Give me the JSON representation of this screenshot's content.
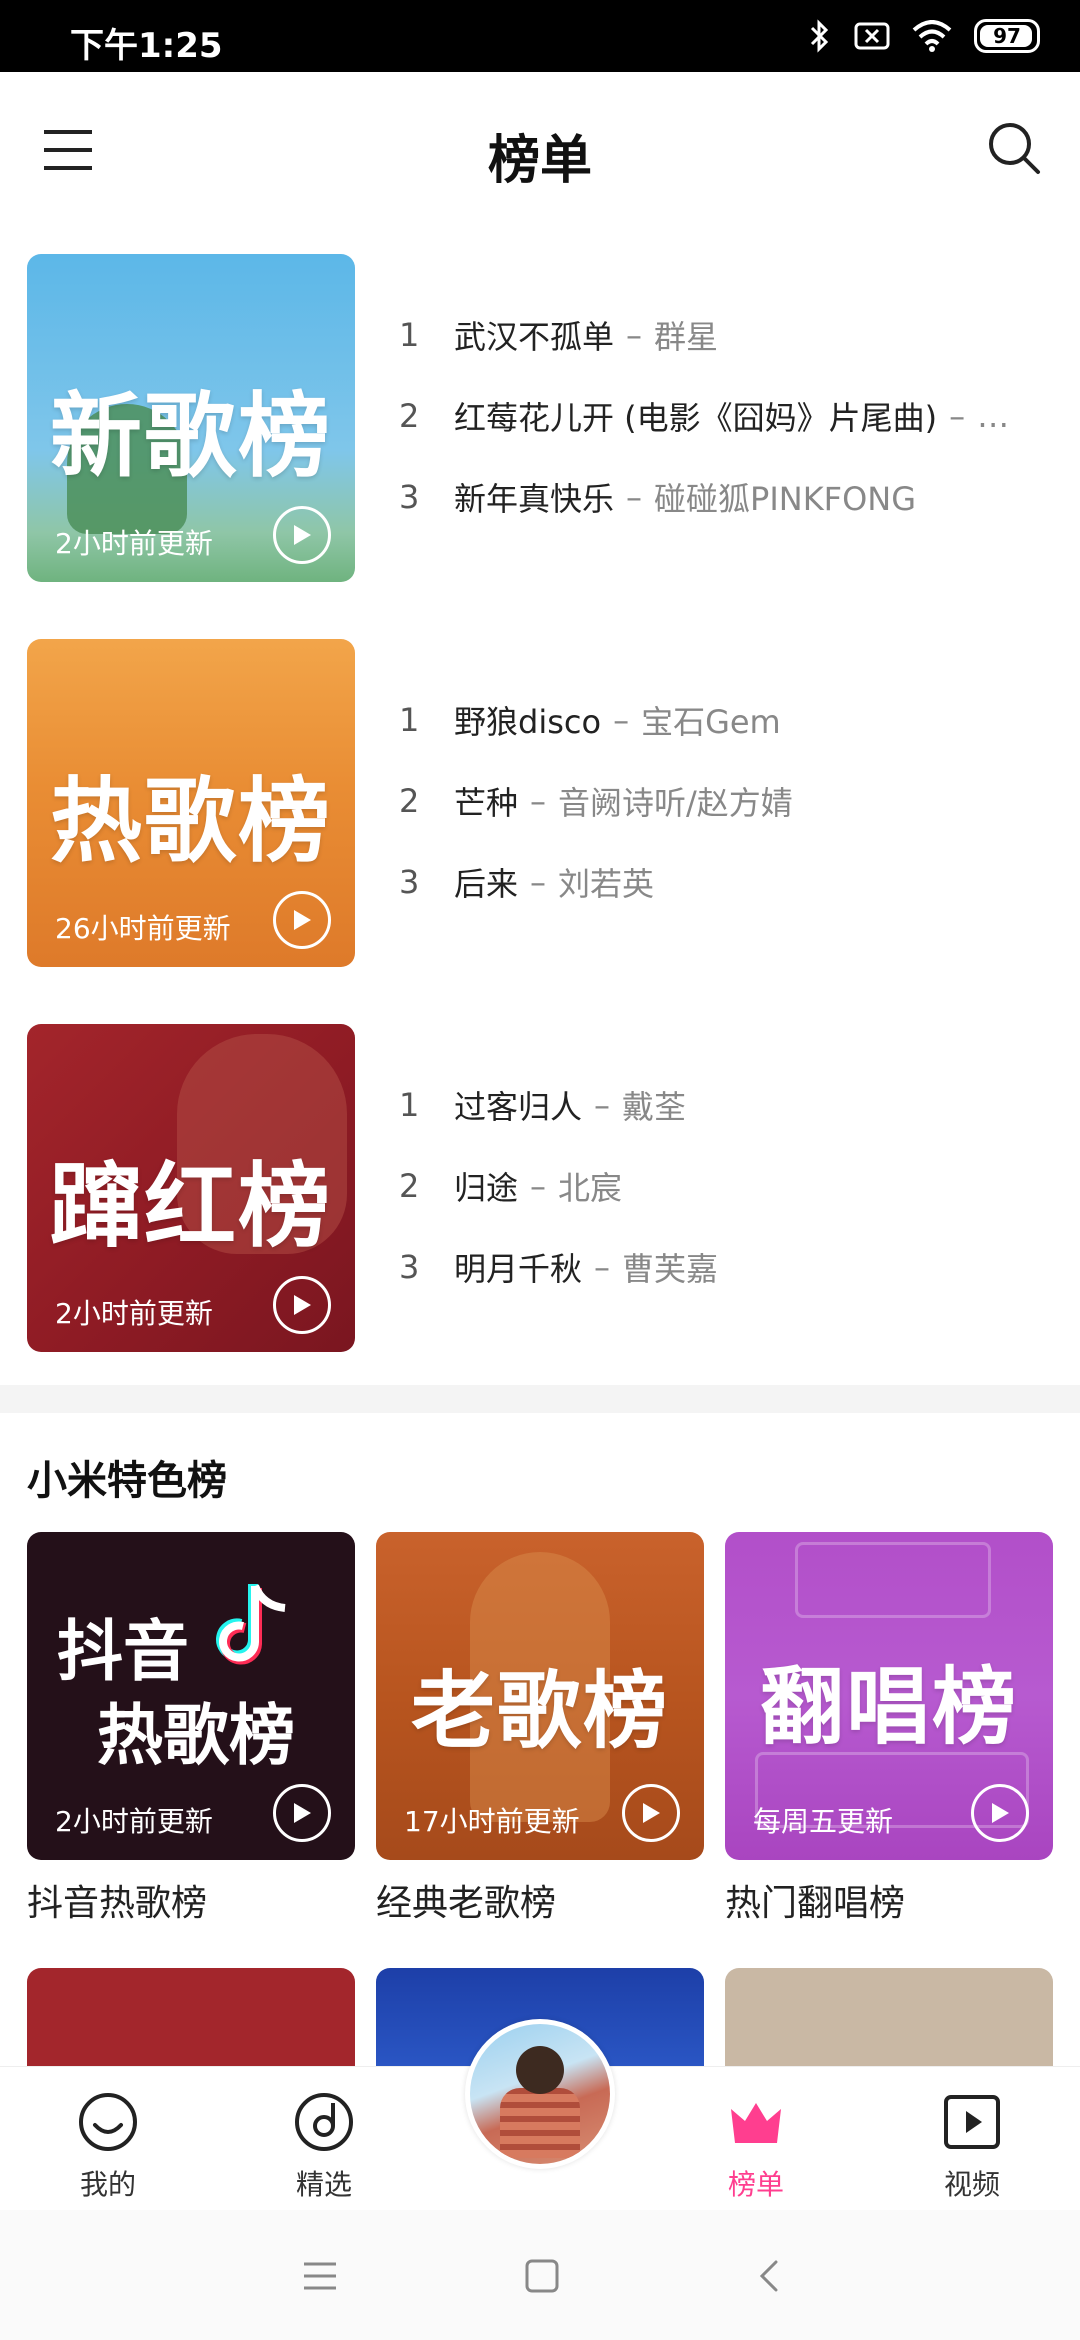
{
  "status_bar": {
    "time": "下午1:25",
    "battery": "97",
    "battery_level": 0.97
  },
  "header": {
    "title": "榜单"
  },
  "charts": [
    {
      "cover_title": "新歌榜",
      "update": "2小时前更新",
      "tracks": [
        {
          "num": "1",
          "song": "武汉不孤单",
          "artist": "群星"
        },
        {
          "num": "2",
          "song": "红莓花儿开 (电影《囧妈》片尾曲)",
          "artist": "…"
        },
        {
          "num": "3",
          "song": "新年真快乐",
          "artist": "碰碰狐PINKFONG"
        }
      ]
    },
    {
      "cover_title": "热歌榜",
      "update": "26小时前更新",
      "tracks": [
        {
          "num": "1",
          "song": "野狼disco",
          "artist": "宝石Gem"
        },
        {
          "num": "2",
          "song": "芒种",
          "artist": "音阙诗听/赵方婧"
        },
        {
          "num": "3",
          "song": "后来",
          "artist": "刘若英"
        }
      ]
    },
    {
      "cover_title": "蹿红榜",
      "update": "2小时前更新",
      "tracks": [
        {
          "num": "1",
          "song": "过客归人",
          "artist": "戴荃"
        },
        {
          "num": "2",
          "song": "归途",
          "artist": "北宸"
        },
        {
          "num": "3",
          "song": "明月千秋",
          "artist": "曹芙嘉"
        }
      ]
    }
  ],
  "featured": {
    "title": "小米特色榜",
    "cards": [
      {
        "cover_line1": "抖音",
        "cover_line2": "热歌榜",
        "update": "2小时前更新",
        "label": "抖音热歌榜"
      },
      {
        "cover_line1": "老歌榜",
        "update": "17小时前更新",
        "label": "经典老歌榜"
      },
      {
        "cover_line1": "翻唱榜",
        "update": "每周五更新",
        "label": "热门翻唱榜"
      }
    ]
  },
  "bottom_nav": {
    "items": [
      {
        "label": "我的",
        "icon": "smile-icon"
      },
      {
        "label": "精选",
        "icon": "disc-icon"
      },
      {
        "label": "榜单",
        "icon": "crown-icon",
        "active": true
      },
      {
        "label": "视频",
        "icon": "video-icon"
      }
    ]
  },
  "colors": {
    "accent": "#ff3e8f"
  }
}
